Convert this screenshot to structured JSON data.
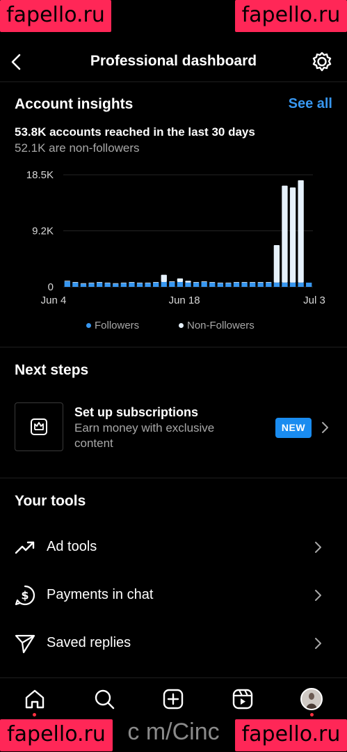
{
  "header": {
    "title": "Professional dashboard"
  },
  "insights": {
    "title": "Account insights",
    "see_all": "See all",
    "reach_text": "53.8K accounts reached in the last 30 days",
    "non_followers_text": "52.1K are non-followers"
  },
  "chart_data": {
    "type": "bar",
    "y_ticks": [
      "18.5K",
      "9.2K",
      "0"
    ],
    "x_ticks": [
      "Jun 4",
      "Jun 18",
      "Jul 3"
    ],
    "ylim": [
      0,
      18500
    ],
    "grid": true,
    "legend_position": "bottom",
    "legend": [
      "Followers",
      "Non-Followers"
    ],
    "colors": {
      "followers": "#3897f0",
      "non_followers": "#e6f1fb"
    },
    "series": [
      {
        "name": "Followers",
        "values": [
          900,
          700,
          500,
          600,
          700,
          600,
          500,
          600,
          700,
          600,
          600,
          700,
          800,
          800,
          800,
          700,
          700,
          800,
          700,
          600,
          600,
          700,
          700,
          700,
          700,
          700,
          700,
          700,
          700,
          700,
          700
        ]
      },
      {
        "name": "Non-Followers",
        "values": [
          100,
          100,
          100,
          100,
          100,
          100,
          100,
          100,
          100,
          100,
          100,
          100,
          1200,
          100,
          600,
          300,
          100,
          100,
          100,
          100,
          100,
          100,
          100,
          100,
          100,
          100,
          6200,
          16000,
          15700,
          16900,
          0
        ]
      }
    ]
  },
  "next_steps": {
    "title": "Next steps",
    "card_title": "Set up subscriptions",
    "card_subtitle": "Earn money with exclusive content",
    "badge": "NEW"
  },
  "tools": {
    "title": "Your tools",
    "items": [
      {
        "label": "Ad tools"
      },
      {
        "label": "Payments in chat"
      },
      {
        "label": "Saved replies"
      }
    ]
  },
  "watermarks": {
    "tl": "fapello.ru",
    "tr": "fapello.ru",
    "bl": "fapello.ru",
    "br": "fapello.ru",
    "url": "c  m/Cinc"
  }
}
